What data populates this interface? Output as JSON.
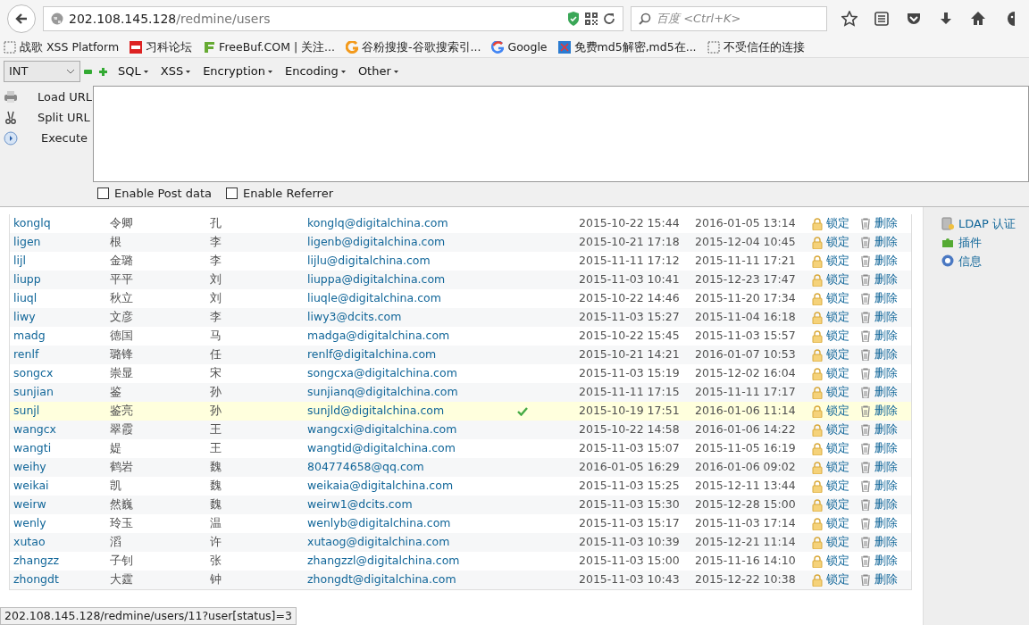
{
  "browser": {
    "url_host": "202.108.145.128",
    "url_path": "/redmine/users",
    "search_placeholder": "百度 <Ctrl+K>"
  },
  "bookmarks": [
    {
      "label": "战歌 XSS Platform",
      "kind": "blank"
    },
    {
      "label": "习科论坛",
      "kind": "slc"
    },
    {
      "label": "FreeBuf.COM | 关注...",
      "kind": "freebuf"
    },
    {
      "label": "谷粉搜搜-谷歌搜索引...",
      "kind": "gfan"
    },
    {
      "label": "Google",
      "kind": "google"
    },
    {
      "label": "免费md5解密,md5在...",
      "kind": "md5"
    },
    {
      "label": "不受信任的连接",
      "kind": "blank"
    }
  ],
  "hackbar": {
    "select": "INT",
    "menus": [
      "SQL",
      "XSS",
      "Encryption",
      "Encoding",
      "Other"
    ],
    "actions": [
      {
        "label": "Load URL",
        "kind": "load"
      },
      {
        "label": "Split URL",
        "kind": "split"
      },
      {
        "label": "Execute",
        "kind": "execute"
      }
    ],
    "options": [
      {
        "label": "Enable Post data",
        "checked": false
      },
      {
        "label": "Enable Referrer",
        "checked": false
      }
    ]
  },
  "users": [
    {
      "login": "konglq",
      "first": "令卿",
      "last": "孔",
      "email": "konglq@digitalchina.com",
      "admin": false,
      "created": "2015-10-22 15:44",
      "last_login": "2016-01-05 13:14",
      "lock": "锁定",
      "delete": "删除",
      "selected": false
    },
    {
      "login": "ligen",
      "first": "根",
      "last": "李",
      "email": "ligenb@digitalchina.com",
      "admin": false,
      "created": "2015-10-21 17:18",
      "last_login": "2015-12-04 10:45",
      "lock": "锁定",
      "delete": "删除",
      "selected": false
    },
    {
      "login": "lijl",
      "first": "金璐",
      "last": "李",
      "email": "lijlu@digitalchina.com",
      "admin": false,
      "created": "2015-11-11 17:12",
      "last_login": "2015-11-11 17:21",
      "lock": "锁定",
      "delete": "删除",
      "selected": false
    },
    {
      "login": "liupp",
      "first": "平平",
      "last": "刘",
      "email": "liuppa@digitalchina.com",
      "admin": false,
      "created": "2015-11-03 10:41",
      "last_login": "2015-12-23 17:47",
      "lock": "锁定",
      "delete": "删除",
      "selected": false
    },
    {
      "login": "liuql",
      "first": "秋立",
      "last": "刘",
      "email": "liuqle@digitalchina.com",
      "admin": false,
      "created": "2015-10-22 14:46",
      "last_login": "2015-11-20 17:34",
      "lock": "锁定",
      "delete": "删除",
      "selected": false
    },
    {
      "login": "liwy",
      "first": "文彦",
      "last": "李",
      "email": "liwy3@dcits.com",
      "admin": false,
      "created": "2015-11-03 15:27",
      "last_login": "2015-11-04 16:18",
      "lock": "锁定",
      "delete": "删除",
      "selected": false
    },
    {
      "login": "madg",
      "first": "德国",
      "last": "马",
      "email": "madga@digitalchina.com",
      "admin": false,
      "created": "2015-10-22 15:45",
      "last_login": "2015-11-03 15:57",
      "lock": "锁定",
      "delete": "删除",
      "selected": false
    },
    {
      "login": "renlf",
      "first": "璐锋",
      "last": "任",
      "email": "renlf@digitalchina.com",
      "admin": false,
      "created": "2015-10-21 14:21",
      "last_login": "2016-01-07 10:53",
      "lock": "锁定",
      "delete": "删除",
      "selected": false
    },
    {
      "login": "songcx",
      "first": "崇显",
      "last": "宋",
      "email": "songcxa@digitalchina.com",
      "admin": false,
      "created": "2015-11-03 15:19",
      "last_login": "2015-12-02 16:04",
      "lock": "锁定",
      "delete": "删除",
      "selected": false
    },
    {
      "login": "sunjian",
      "first": "鉴",
      "last": "孙",
      "email": "sunjianq@digitalchina.com",
      "admin": false,
      "created": "2015-11-11 17:15",
      "last_login": "2015-11-11 17:17",
      "lock": "锁定",
      "delete": "删除",
      "selected": false
    },
    {
      "login": "sunjl",
      "first": "鉴亮",
      "last": "孙",
      "email": "sunjld@digitalchina.com",
      "admin": true,
      "created": "2015-10-19 17:51",
      "last_login": "2016-01-06 11:14",
      "lock": "锁定",
      "delete": "删除",
      "selected": true
    },
    {
      "login": "wangcx",
      "first": "翠霞",
      "last": "王",
      "email": "wangcxi@digitalchina.com",
      "admin": false,
      "created": "2015-10-22 14:58",
      "last_login": "2016-01-06 14:22",
      "lock": "锁定",
      "delete": "删除",
      "selected": false
    },
    {
      "login": "wangti",
      "first": "媞",
      "last": "王",
      "email": "wangtid@digitalchina.com",
      "admin": false,
      "created": "2015-11-03 15:07",
      "last_login": "2015-11-05 16:19",
      "lock": "锁定",
      "delete": "删除",
      "selected": false
    },
    {
      "login": "weihy",
      "first": "鹤岩",
      "last": "魏",
      "email": "804774658@qq.com",
      "admin": false,
      "created": "2016-01-05 16:29",
      "last_login": "2016-01-06 09:02",
      "lock": "锁定",
      "delete": "删除",
      "selected": false
    },
    {
      "login": "weikai",
      "first": "凯",
      "last": "魏",
      "email": "weikaia@digitalchina.com",
      "admin": false,
      "created": "2015-11-03 15:25",
      "last_login": "2015-12-11 13:44",
      "lock": "锁定",
      "delete": "删除",
      "selected": false
    },
    {
      "login": "weirw",
      "first": "然巍",
      "last": "魏",
      "email": "weirw1@dcits.com",
      "admin": false,
      "created": "2015-11-03 15:30",
      "last_login": "2015-12-28 15:00",
      "lock": "锁定",
      "delete": "删除",
      "selected": false
    },
    {
      "login": "wenly",
      "first": "玲玉",
      "last": "温",
      "email": "wenlyb@digitalchina.com",
      "admin": false,
      "created": "2015-11-03 15:17",
      "last_login": "2015-11-03 17:14",
      "lock": "锁定",
      "delete": "删除",
      "selected": false
    },
    {
      "login": "xutao",
      "first": "滔",
      "last": "许",
      "email": "xutaog@digitalchina.com",
      "admin": false,
      "created": "2015-11-03 10:39",
      "last_login": "2015-12-21 11:14",
      "lock": "锁定",
      "delete": "删除",
      "selected": false
    },
    {
      "login": "zhangzz",
      "first": "子钊",
      "last": "张",
      "email": "zhangzzl@digitalchina.com",
      "admin": false,
      "created": "2015-11-03 15:00",
      "last_login": "2015-11-16 14:10",
      "lock": "锁定",
      "delete": "删除",
      "selected": false
    },
    {
      "login": "zhongdt",
      "first": "大霆",
      "last": "钟",
      "email": "zhongdt@digitalchina.com",
      "admin": false,
      "created": "2015-11-03 10:43",
      "last_login": "2015-12-22 10:38",
      "lock": "锁定",
      "delete": "删除",
      "selected": false
    }
  ],
  "sidebar": [
    {
      "label": "LDAP 认证",
      "kind": "ldap"
    },
    {
      "label": "插件",
      "kind": "plugin"
    },
    {
      "label": "信息",
      "kind": "info"
    }
  ],
  "status_bar": "202.108.145.128/redmine/users/11?user[status]=3"
}
